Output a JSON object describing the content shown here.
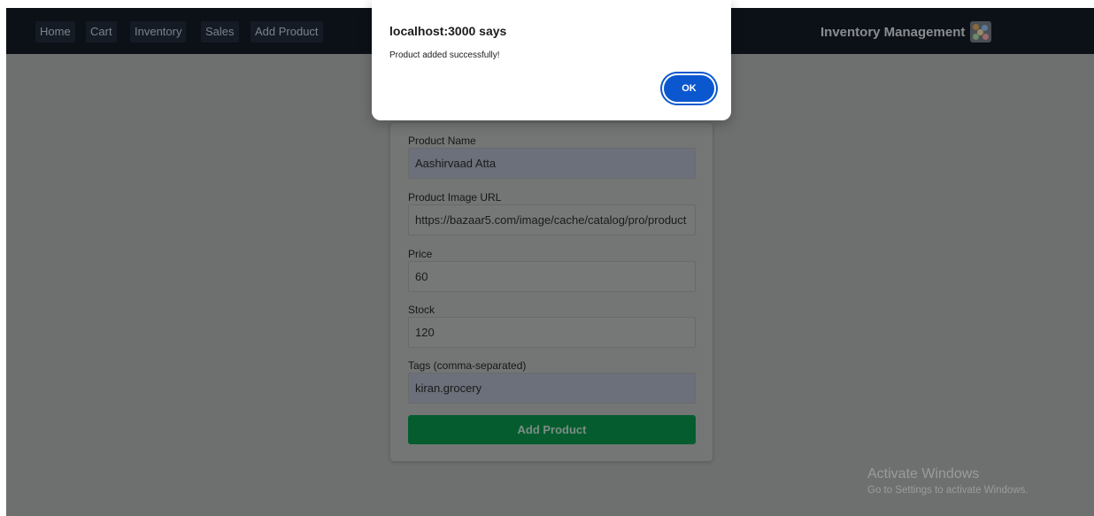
{
  "navbar": {
    "links": [
      {
        "label": "Home"
      },
      {
        "label": "Cart"
      },
      {
        "label": "Inventory"
      },
      {
        "label": "Sales"
      },
      {
        "label": "Add Product"
      }
    ],
    "brand": "Inventory Management",
    "brand_icon": "inventory-logo-icon"
  },
  "form": {
    "fields": [
      {
        "label": "Product Name",
        "value": "Aashirvaad Atta"
      },
      {
        "label": "Product Image URL",
        "value": "https://bazaar5.com/image/cache/catalog/pro/product"
      },
      {
        "label": "Price",
        "value": "60"
      },
      {
        "label": "Stock",
        "value": "120"
      },
      {
        "label": "Tags (comma-separated)",
        "value": "kiran.grocery"
      }
    ],
    "submit_label": "Add Product",
    "submit_color": "#055d2f"
  },
  "dialog": {
    "title": "localhost:3000 says",
    "message": "Product added successfully!",
    "ok_label": "OK",
    "ok_color": "#0b57d0"
  },
  "watermark": {
    "title": "Activate Windows",
    "subtitle": "Go to Settings to activate Windows."
  }
}
